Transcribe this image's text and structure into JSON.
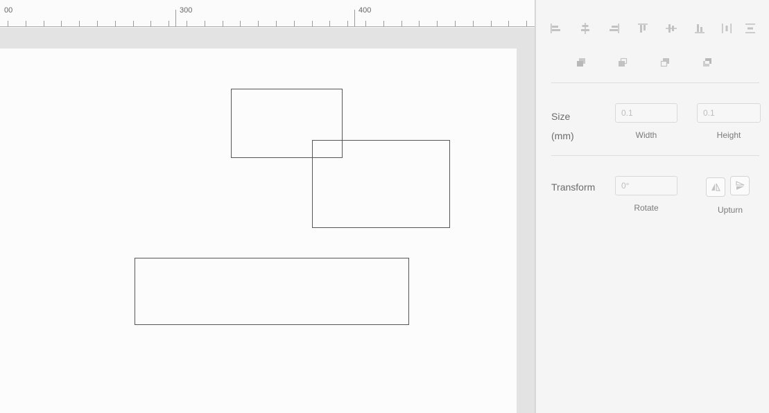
{
  "ruler": {
    "labels": [
      "00",
      "300",
      "400"
    ]
  },
  "panel": {
    "align_icons": [
      "align-left-icon",
      "align-center-horizontal-icon",
      "align-right-icon",
      "align-top-icon",
      "align-middle-vertical-icon",
      "align-bottom-icon",
      "distribute-horizontal-icon",
      "distribute-vertical-icon"
    ],
    "arrange_icons": [
      "bring-to-front-icon",
      "bring-forward-icon",
      "send-backward-icon",
      "send-to-back-icon"
    ],
    "size": {
      "label_line1": "Size",
      "label_line2": "(mm)",
      "width_value": "0.1",
      "height_value": "0.1",
      "width_caption": "Width",
      "height_caption": "Height"
    },
    "transform": {
      "label": "Transform",
      "rotate_value": "0°",
      "rotate_caption": "Rotate",
      "upturn_caption": "Upturn"
    }
  },
  "colors": {
    "icon": "#c2c2c2",
    "shape_stroke": "#555555",
    "canvas_bg": "#fcfcfc",
    "workspace_bg": "#e3e3e3",
    "panel_bg": "#f5f5f5"
  }
}
